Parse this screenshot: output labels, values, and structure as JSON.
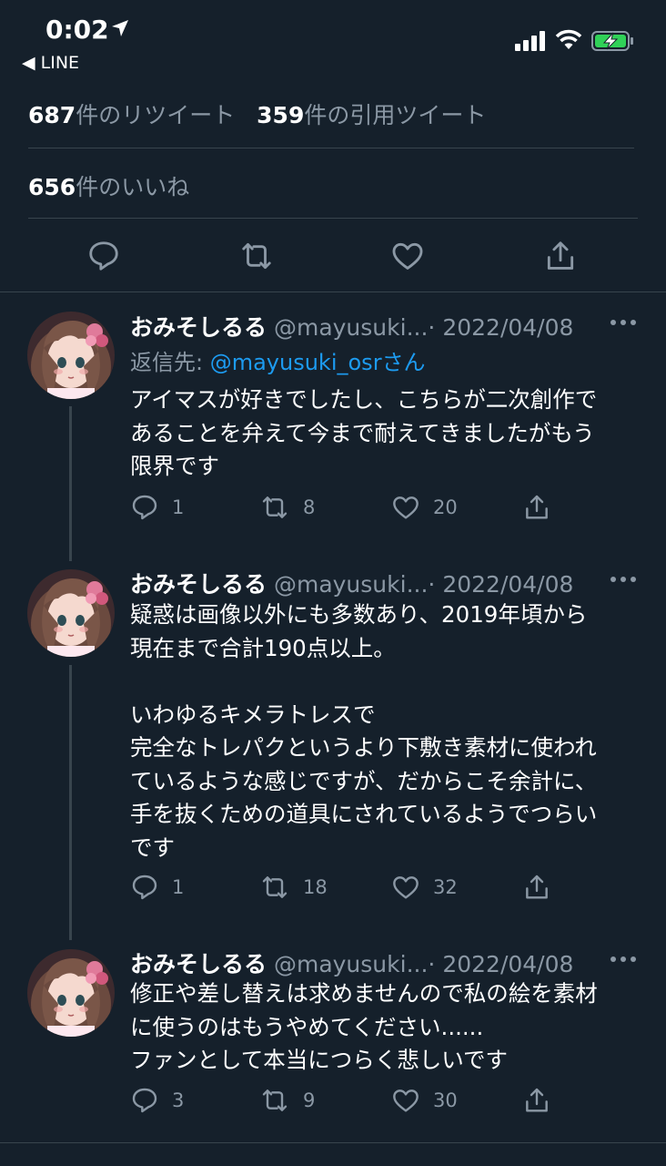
{
  "status_bar": {
    "time": "0:02",
    "back_label": "◀ LINE"
  },
  "stats": {
    "retweets_count": "687",
    "retweets_label": "件のリツイート",
    "quotes_count": "359",
    "quotes_label": "件の引用ツイート",
    "likes_count": "656",
    "likes_label": "件のいいね"
  },
  "tweets": [
    {
      "name": "おみそしるる",
      "handle": "@mayusuki...",
      "date": "· 2022/04/08",
      "reply_prefix": "返信先: ",
      "reply_mention": "@mayusuki_osr",
      "reply_suffix": "さん",
      "text": "アイマスが好きでしたし、こちらが二次創作で\nあることを弁えて今まで耐えてきましたがもう\n限界です",
      "replies": "1",
      "retweets": "8",
      "likes": "20"
    },
    {
      "name": "おみそしるる",
      "handle": "@mayusuki...",
      "date": "· 2022/04/08",
      "text": "疑惑は画像以外にも多数あり、2019年頃から\n現在まで合計190点以上。\n\nいわゆるキメラトレスで\n完全なトレパクというより下敷き素材に使われ\nているような感じですが、だからこそ余計に、\n手を抜くための道具にされているようでつらい\nです",
      "replies": "1",
      "retweets": "18",
      "likes": "32"
    },
    {
      "name": "おみそしるる",
      "handle": "@mayusuki...",
      "date": "· 2022/04/08",
      "text": "修正や差し替えは求めませんので私の絵を素材\nに使うのはもうやめてください......\nファンとして本当につらく悲しいです",
      "replies": "3",
      "retweets": "9",
      "likes": "30"
    }
  ],
  "colors": {
    "background": "#15202b",
    "secondary_text": "#8b98a5",
    "link": "#1d9bf0",
    "divider": "#38444d"
  }
}
